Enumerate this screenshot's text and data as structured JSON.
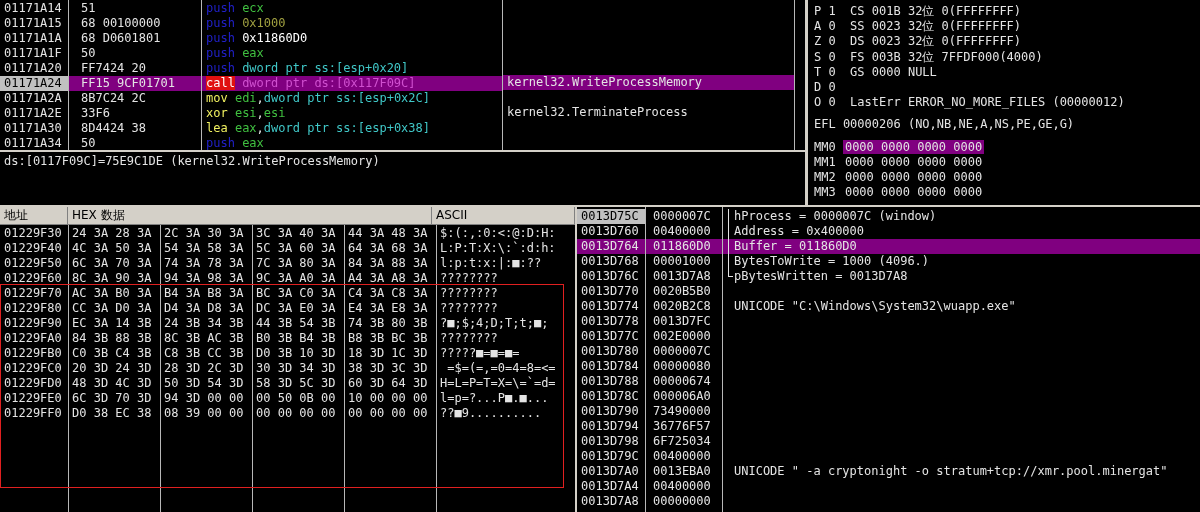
{
  "disassembly": {
    "rows": [
      {
        "address": "01171A14",
        "bytes": "51",
        "instruction": [
          {
            "text": "push",
            "kind": "mnemonic"
          },
          {
            "text": "ecx",
            "kind": "reg"
          }
        ],
        "comment": "",
        "selected": false
      },
      {
        "address": "01171A15",
        "bytes": "68 00100000",
        "instruction": [
          {
            "text": "push",
            "kind": "mnemonic"
          },
          {
            "text": "0x1000",
            "kind": "imm"
          }
        ],
        "comment": "",
        "selected": false
      },
      {
        "address": "01171A1A",
        "bytes": "68 D0601801",
        "instruction": [
          {
            "text": "push",
            "kind": "mnemonic"
          },
          {
            "text": "0x11860D0",
            "kind": "const"
          }
        ],
        "comment": "",
        "selected": false
      },
      {
        "address": "01171A1F",
        "bytes": "50",
        "instruction": [
          {
            "text": "push",
            "kind": "mnemonic"
          },
          {
            "text": "eax",
            "kind": "reg"
          }
        ],
        "comment": "",
        "selected": false
      },
      {
        "address": "01171A20",
        "bytes": "FF7424 20",
        "instruction": [
          {
            "text": "push",
            "kind": "mnemonic"
          },
          {
            "text": "dword ptr ss:[esp+0x20]",
            "kind": "mem"
          }
        ],
        "comment": "",
        "selected": false
      },
      {
        "address": "01171A24",
        "bytes": "FF15 9CF01701",
        "instruction": [
          {
            "text": "call",
            "kind": "call"
          },
          {
            "text": "dword ptr ds:[0x117F09C]",
            "kind": "mem"
          }
        ],
        "comment": "kernel32.WriteProcessMemory",
        "selected": true
      },
      {
        "address": "01171A2A",
        "bytes": "8B7C24 2C",
        "instruction": [
          {
            "text": "mov",
            "kind": "op"
          },
          {
            "text": "edi",
            "kind": "reg"
          },
          {
            "text": ",",
            "kind": "punct"
          },
          {
            "text": "dword ptr ss:[esp+0x2C]",
            "kind": "mem"
          }
        ],
        "comment": "",
        "selected": false
      },
      {
        "address": "01171A2E",
        "bytes": "33F6",
        "instruction": [
          {
            "text": "xor",
            "kind": "op"
          },
          {
            "text": "esi",
            "kind": "reg"
          },
          {
            "text": ",",
            "kind": "punct"
          },
          {
            "text": "esi",
            "kind": "reg"
          }
        ],
        "comment": "kernel32.TerminateProcess",
        "selected": false
      },
      {
        "address": "01171A30",
        "bytes": "8D4424 38",
        "instruction": [
          {
            "text": "lea",
            "kind": "op"
          },
          {
            "text": "eax",
            "kind": "reg"
          },
          {
            "text": ",",
            "kind": "punct"
          },
          {
            "text": "dword ptr ss:[esp+0x38]",
            "kind": "mem"
          }
        ],
        "comment": "",
        "selected": false
      },
      {
        "address": "01171A34",
        "bytes": "50",
        "instruction": [
          {
            "text": "push",
            "kind": "mnemonic"
          },
          {
            "text": "eax",
            "kind": "reg"
          }
        ],
        "comment": "",
        "selected": false
      }
    ]
  },
  "info_line": "ds:[0117F09C]=75E9C1DE (kernel32.WriteProcessMemory)",
  "registers": {
    "lines": [
      "P 1  CS 001B 32位 0(FFFFFFFF)",
      "A 0  SS 0023 32位 0(FFFFFFFF)",
      "Z 0  DS 0023 32位 0(FFFFFFFF)",
      "S 0  FS 003B 32位 7FFDF000(4000)",
      "T 0  GS 0000 NULL",
      "D 0",
      "O 0  LastErr ERROR_NO_MORE_FILES (00000012)"
    ],
    "eflags": "EFL 00000206 (NO,NB,NE,A,NS,PE,GE,G)",
    "mmx": [
      {
        "name": "MM0",
        "value": "0000 0000 0000 0000",
        "selected": true
      },
      {
        "name": "MM1",
        "value": "0000 0000 0000 0000",
        "selected": false
      },
      {
        "name": "MM2",
        "value": "0000 0000 0000 0000",
        "selected": false
      },
      {
        "name": "MM3",
        "value": "0000 0000 0000 0000",
        "selected": false
      }
    ]
  },
  "dump": {
    "columns": [
      "地址",
      "HEX 数据",
      "ASCII"
    ],
    "rows": [
      {
        "address": "01229F30",
        "groups": [
          "24 3A 28 3A",
          "2C 3A 30 3A",
          "3C 3A 40 3A",
          "44 3A 48 3A"
        ],
        "ascii": "$:(:,:0:<:@:D:H:"
      },
      {
        "address": "01229F40",
        "groups": [
          "4C 3A 50 3A",
          "54 3A 58 3A",
          "5C 3A 60 3A",
          "64 3A 68 3A"
        ],
        "ascii": "L:P:T:X:\\:`:d:h:"
      },
      {
        "address": "01229F50",
        "groups": [
          "6C 3A 70 3A",
          "74 3A 78 3A",
          "7C 3A 80 3A",
          "84 3A 88 3A"
        ],
        "ascii": "l:p:t:x:|:■:??"
      },
      {
        "address": "01229F60",
        "groups": [
          "8C 3A 90 3A",
          "94 3A 98 3A",
          "9C 3A A0 3A",
          "A4 3A A8 3A"
        ],
        "ascii": "????????"
      },
      {
        "address": "01229F70",
        "groups": [
          "AC 3A B0 3A",
          "B4 3A B8 3A",
          "BC 3A C0 3A",
          "C4 3A C8 3A"
        ],
        "ascii": "????????"
      },
      {
        "address": "01229F80",
        "groups": [
          "CC 3A D0 3A",
          "D4 3A D8 3A",
          "DC 3A E0 3A",
          "E4 3A E8 3A"
        ],
        "ascii": "????????"
      },
      {
        "address": "01229F90",
        "groups": [
          "EC 3A 14 3B",
          "24 3B 34 3B",
          "44 3B 54 3B",
          "74 3B 80 3B"
        ],
        "ascii": "?■;$;4;D;T;t;■;"
      },
      {
        "address": "01229FA0",
        "groups": [
          "84 3B 88 3B",
          "8C 3B AC 3B",
          "B0 3B B4 3B",
          "B8 3B BC 3B"
        ],
        "ascii": "????????"
      },
      {
        "address": "01229FB0",
        "groups": [
          "C0 3B C4 3B",
          "C8 3B CC 3B",
          "D0 3B 10 3D",
          "18 3D 1C 3D"
        ],
        "ascii": "?????■=■=■="
      },
      {
        "address": "01229FC0",
        "groups": [
          "20 3D 24 3D",
          "28 3D 2C 3D",
          "30 3D 34 3D",
          "38 3D 3C 3D"
        ],
        "ascii": " =$=(=,=0=4=8=<="
      },
      {
        "address": "01229FD0",
        "groups": [
          "48 3D 4C 3D",
          "50 3D 54 3D",
          "58 3D 5C 3D",
          "60 3D 64 3D"
        ],
        "ascii": "H=L=P=T=X=\\=`=d="
      },
      {
        "address": "01229FE0",
        "groups": [
          "6C 3D 70 3D",
          "94 3D 00 00",
          "00 50 0B 00",
          "10 00 00 00"
        ],
        "ascii": "l=p=?...P■.■..."
      },
      {
        "address": "01229FF0",
        "groups": [
          "D0 38 EC 38",
          "08 39 00 00",
          "00 00 00 00",
          "00 00 00 00"
        ],
        "ascii": "??■9.........."
      }
    ]
  },
  "stack": {
    "rows": [
      {
        "address": "0013D75C",
        "value": "0000007C",
        "comment": "hProcess = 0000007C (window)",
        "kind": "arg",
        "current": true,
        "selected": false
      },
      {
        "address": "0013D760",
        "value": "00400000",
        "comment": "Address = 0x400000",
        "kind": "arg",
        "current": false,
        "selected": false
      },
      {
        "address": "0013D764",
        "value": "011860D0",
        "comment": "Buffer = 011860D0",
        "kind": "arg",
        "current": false,
        "selected": true
      },
      {
        "address": "0013D768",
        "value": "00001000",
        "comment": "BytesToWrite = 1000 (4096.)",
        "kind": "arg",
        "current": false,
        "selected": false
      },
      {
        "address": "0013D76C",
        "value": "0013D7A8",
        "comment": "pBytesWritten = 0013D7A8",
        "kind": "arg-end",
        "current": false,
        "selected": false
      },
      {
        "address": "0013D770",
        "value": "0020B5B0",
        "comment": "",
        "kind": "plain",
        "current": false,
        "selected": false
      },
      {
        "address": "0013D774",
        "value": "0020B2C8",
        "comment": "UNICODE \"C:\\Windows\\System32\\wuapp.exe\"",
        "kind": "plain",
        "current": false,
        "selected": false
      },
      {
        "address": "0013D778",
        "value": "0013D7FC",
        "comment": "",
        "kind": "plain",
        "current": false,
        "selected": false
      },
      {
        "address": "0013D77C",
        "value": "002E0000",
        "comment": "",
        "kind": "plain",
        "current": false,
        "selected": false
      },
      {
        "address": "0013D780",
        "value": "0000007C",
        "comment": "",
        "kind": "plain",
        "current": false,
        "selected": false
      },
      {
        "address": "0013D784",
        "value": "00000080",
        "comment": "",
        "kind": "plain",
        "current": false,
        "selected": false
      },
      {
        "address": "0013D788",
        "value": "00000674",
        "comment": "",
        "kind": "plain",
        "current": false,
        "selected": false
      },
      {
        "address": "0013D78C",
        "value": "000006A0",
        "comment": "",
        "kind": "plain",
        "current": false,
        "selected": false
      },
      {
        "address": "0013D790",
        "value": "73490000",
        "comment": "",
        "kind": "plain",
        "current": false,
        "selected": false
      },
      {
        "address": "0013D794",
        "value": "36776F57",
        "comment": "",
        "kind": "plain",
        "current": false,
        "selected": false
      },
      {
        "address": "0013D798",
        "value": "6F725034",
        "comment": "",
        "kind": "plain",
        "current": false,
        "selected": false
      },
      {
        "address": "0013D79C",
        "value": "00400000",
        "comment": "",
        "kind": "plain",
        "current": false,
        "selected": false
      },
      {
        "address": "0013D7A0",
        "value": "0013EBA0",
        "comment": "UNICODE \" -a cryptonight -o stratum+tcp://xmr.pool.minergat\"",
        "kind": "plain",
        "current": false,
        "selected": false
      },
      {
        "address": "0013D7A4",
        "value": "00400000",
        "comment": "",
        "kind": "plain",
        "current": false,
        "selected": false
      },
      {
        "address": "0013D7A8",
        "value": "00000000",
        "comment": "",
        "kind": "plain",
        "current": false,
        "selected": false
      }
    ]
  }
}
